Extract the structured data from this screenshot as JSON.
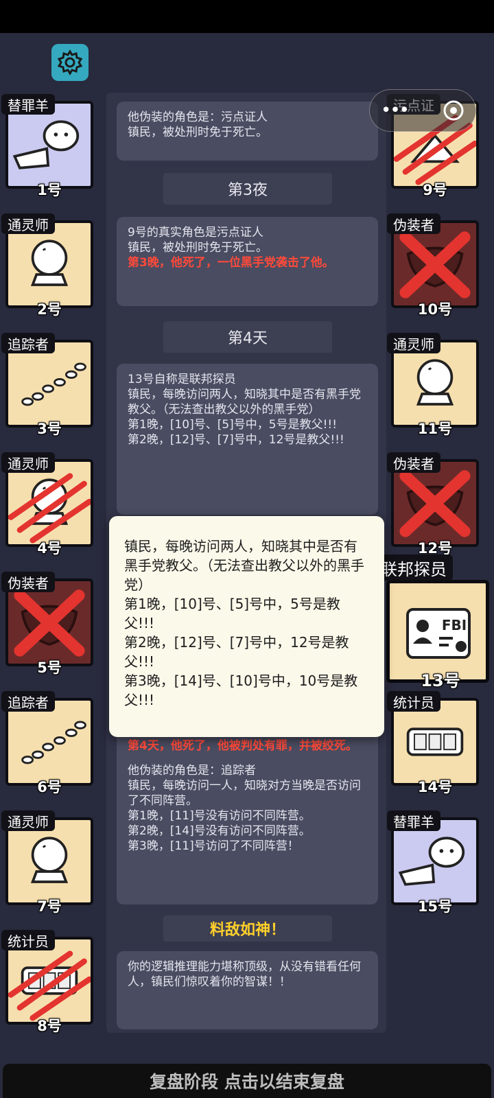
{
  "settings_icon": "gear-icon",
  "left_cards": [
    {
      "role": "替罪羊",
      "num": "1号",
      "icon": "sheep-pointing-icon",
      "bg": "#cbcbf1",
      "dead": false,
      "slashed": false
    },
    {
      "role": "通灵师",
      "num": "2号",
      "icon": "crystal-ball-icon",
      "bg": "#f6dfae",
      "dead": false,
      "slashed": false
    },
    {
      "role": "追踪者",
      "num": "3号",
      "icon": "footprints-icon",
      "bg": "#f6dfae",
      "dead": false,
      "slashed": false
    },
    {
      "role": "通灵师",
      "num": "4号",
      "icon": "crystal-ball-icon",
      "bg": "#f6dfae",
      "dead": false,
      "slashed": true
    },
    {
      "role": "伪装者",
      "num": "5号",
      "icon": "mask-icon",
      "bg": "#6b2a2a",
      "dead": true,
      "slashed": false
    },
    {
      "role": "追踪者",
      "num": "6号",
      "icon": "footprints-icon",
      "bg": "#f6dfae",
      "dead": false,
      "slashed": false
    },
    {
      "role": "通灵师",
      "num": "7号",
      "icon": "crystal-ball-icon",
      "bg": "#f6dfae",
      "dead": false,
      "slashed": false
    },
    {
      "role": "统计员",
      "num": "8号",
      "icon": "counter-icon",
      "bg": "#f6dfae",
      "dead": false,
      "slashed": true
    }
  ],
  "right_cards": [
    {
      "role": "污点证",
      "num": "9号",
      "icon": "witness-icon",
      "bg": "#f6dfae",
      "dead": false,
      "slashed": true
    },
    {
      "role": "伪装者",
      "num": "10号",
      "icon": "mask-icon",
      "bg": "#6b2a2a",
      "dead": true,
      "slashed": false
    },
    {
      "role": "通灵师",
      "num": "11号",
      "icon": "crystal-ball-icon",
      "bg": "#f6dfae",
      "dead": false,
      "slashed": false
    },
    {
      "role": "伪装者",
      "num": "12号",
      "icon": "mask-icon",
      "bg": "#6b2a2a",
      "dead": true,
      "slashed": false
    },
    {
      "role": "联邦探员",
      "num": "13号",
      "icon": "fbi-badge-icon",
      "bg": "#f6dfae",
      "dead": false,
      "slashed": false
    },
    {
      "role": "统计员",
      "num": "14号",
      "icon": "counter-icon",
      "bg": "#f6dfae",
      "dead": false,
      "slashed": false
    },
    {
      "role": "替罪羊",
      "num": "15号",
      "icon": "sheep-pointing-icon",
      "bg": "#cbcbf1",
      "dead": false,
      "slashed": false
    }
  ],
  "log": {
    "msg1": [
      "他伪装的角色是：污点证人",
      "镇民，被处刑时免于死亡。"
    ],
    "night3": "第3夜",
    "msg2": [
      "9号的真实角色是污点证人",
      "镇民，被处刑时免于死亡。"
    ],
    "msg2_red": "第3晚，他死了，一位黑手党袭击了他。",
    "day4": "第4天",
    "msg3": [
      "13号自称是联邦探员",
      "镇民，每晚访问两人，知晓其中是否有黑手党教父。（无法查出教父以外的黑手党）",
      "第1晚，[10]号、[5]号中，5号是教父!!!",
      "第2晚，[12]号、[7]号中，12号是教父!!!"
    ],
    "msg4_red": "第4天，他死了，他被判处有罪，并被绞死。",
    "msg4": [
      "他伪装的角色是：追踪者",
      "镇民，每晚访问一人，知晓对方当晚是否访问了不同阵营。",
      "第1晚，[11]号没有访问不同阵营。",
      "第2晚，[14]号没有访问不同阵营。",
      "第3晚，[11]号访问了不同阵营！"
    ],
    "title": "料敌如神！",
    "msg5": "你的逻辑推理能力堪称顶级，从没有错看任何人，镇民们惊叹着你的智谋！！"
  },
  "popup": [
    "镇民，每晚访问两人，知晓其中是否有黑手党教父。（无法查出教父以外的黑手党）",
    "第1晚，[10]号、[5]号中，5号是教父!!!",
    "第2晚，[12]号、[7]号中，12号是教父!!!",
    "第3晚，[14]号、[10]号中，10号是教父!!!"
  ],
  "footer": "复盘阶段 点击以结束复盘",
  "capsule": {
    "more_icon": "more-dots-icon",
    "close_icon": "target-close-icon"
  }
}
